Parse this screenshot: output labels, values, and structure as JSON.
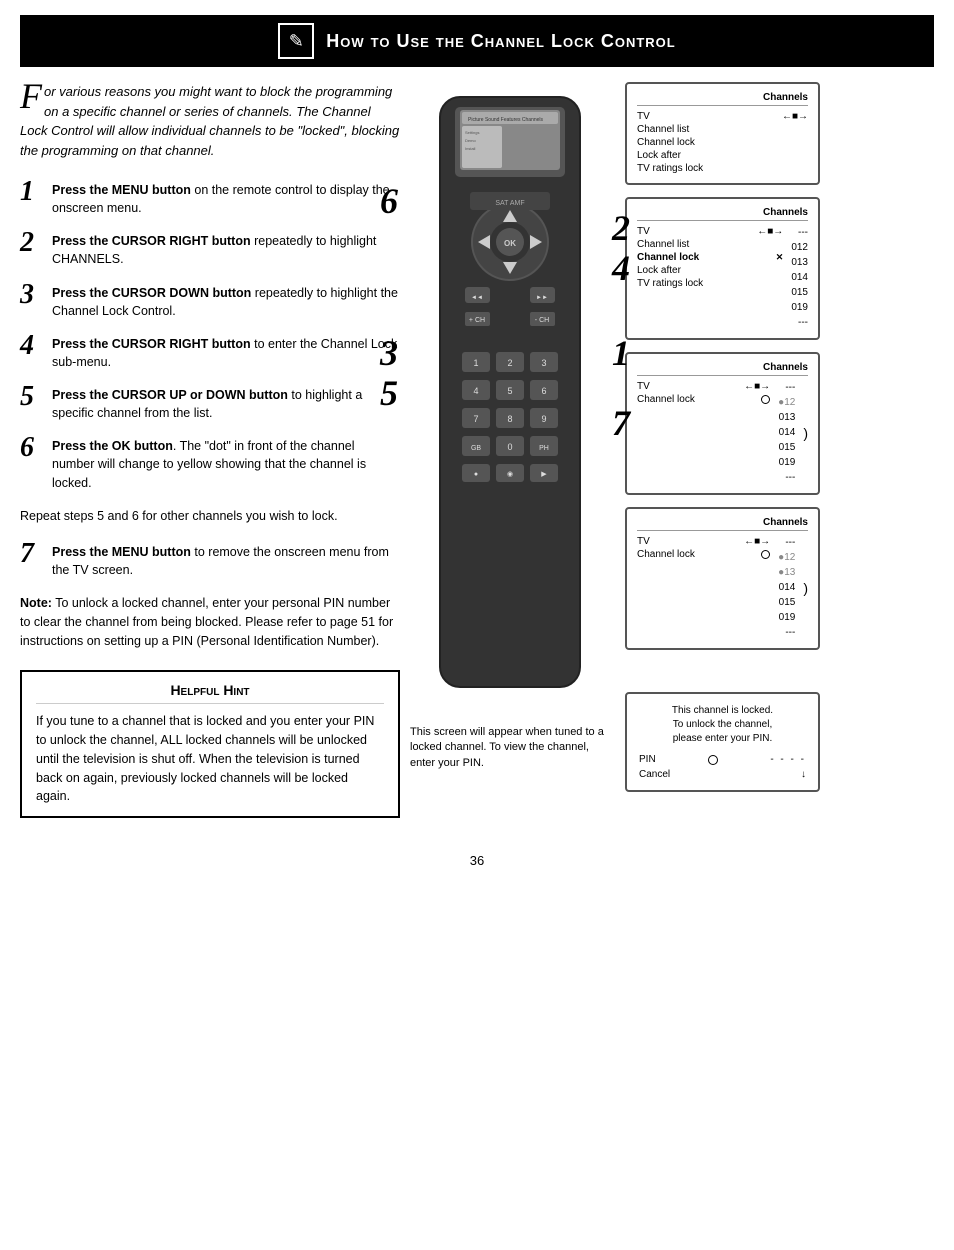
{
  "header": {
    "title": "How to Use the Channel Lock Control",
    "icon_symbol": "✎"
  },
  "intro": {
    "drop_cap": "F",
    "text": "or various reasons you might want to block the programming on a specific channel or series of channels. The Channel Lock Control will allow individual channels to be \"locked\", blocking the programming on that channel."
  },
  "steps": [
    {
      "num": "1",
      "text_html": "<strong>Press the MENU button</strong> on the remote control to display the onscreen menu."
    },
    {
      "num": "2",
      "text_html": "<strong>Press the CURSOR RIGHT button</strong> repeatedly to highlight CHANNELS."
    },
    {
      "num": "3",
      "text_html": "<strong>Press the CURSOR DOWN button</strong> repeatedly to highlight the Channel Lock Control."
    },
    {
      "num": "4",
      "text_html": "<strong>Press the CURSOR RIGHT button</strong> to enter the Channel Lock sub-menu."
    },
    {
      "num": "5",
      "text_html": "<strong>Press the CURSOR UP or DOWN button</strong> to highlight a specific channel from the list."
    },
    {
      "num": "6",
      "text_html": "<strong>Press the OK button</strong>. The \"dot\" in front of the channel number will change to yellow showing that the channel is locked."
    }
  ],
  "repeat_text": "Repeat steps 5 and 6 for other channels you wish to lock.",
  "step7": {
    "num": "7",
    "text_html": "<strong>Press the MENU button</strong> to remove the onscreen menu from the TV screen."
  },
  "note": {
    "label": "Note:",
    "text": "To unlock a locked channel, enter your personal PIN number to clear the channel from being blocked. Please refer to page 51 for instructions on setting up a PIN (Personal Identification Number)."
  },
  "hint": {
    "title": "Helpful Hint",
    "text": "If you tune to a channel that is locked and you enter your PIN to unlock the channel, ALL locked channels will be unlocked until the television is shut off. When the television is turned back on again, previously locked channels will be locked again."
  },
  "screens": [
    {
      "id": "screen1",
      "header": "Channels",
      "rows": [
        {
          "label": "TV",
          "arrow": "→",
          "active": false
        },
        {
          "label": "Channel list",
          "arrow": "",
          "active": false
        },
        {
          "label": "Channel lock",
          "arrow": "",
          "active": false
        },
        {
          "label": "Lock after",
          "arrow": "",
          "active": false
        },
        {
          "label": "TV ratings lock",
          "arrow": "",
          "active": false
        }
      ],
      "channels": []
    },
    {
      "id": "screen2",
      "header": "Channels",
      "rows": [
        {
          "label": "TV",
          "arrow": "→",
          "active": false
        },
        {
          "label": "Channel list",
          "arrow": "",
          "active": false
        },
        {
          "label": "Channel lock",
          "arrow": "✕",
          "active": true
        },
        {
          "label": "Lock after",
          "arrow": "",
          "active": false
        },
        {
          "label": "TV ratings lock",
          "arrow": "",
          "active": false
        }
      ],
      "channels": [
        "---",
        "012",
        "013",
        "014",
        "015",
        "019",
        "---"
      ]
    },
    {
      "id": "screen3",
      "header": "Channels",
      "rows": [
        {
          "label": "TV",
          "arrow": "→",
          "active": false
        },
        {
          "label": "Channel lock",
          "arrow": "",
          "active": false
        }
      ],
      "channels": [
        "---",
        "●12",
        "013",
        "014",
        "015",
        "019",
        "---"
      ],
      "has_lock": true
    },
    {
      "id": "screen4",
      "header": "Channels",
      "rows": [
        {
          "label": "TV",
          "arrow": "→",
          "active": false
        },
        {
          "label": "Channel lock",
          "arrow": "",
          "active": false
        }
      ],
      "channels": [
        "---",
        "●12",
        "●13",
        "014",
        "015",
        "019",
        "---"
      ],
      "has_lock": true
    }
  ],
  "pin_screen": {
    "title": "This channel is locked.\nTo unlock the channel,\nplease enter your PIN.",
    "pin_label": "PIN",
    "pin_value": "- - - -",
    "cancel_label": "Cancel"
  },
  "bottom_caption": "This screen will appear when tuned to a locked channel. To view the channel, enter your PIN.",
  "page_number": "36",
  "remote_numbers": {
    "label_2": "2",
    "label_4": "4",
    "label_6": "6",
    "label_7": "7",
    "label_1": "1",
    "label_3": "3",
    "label_5": "5"
  }
}
